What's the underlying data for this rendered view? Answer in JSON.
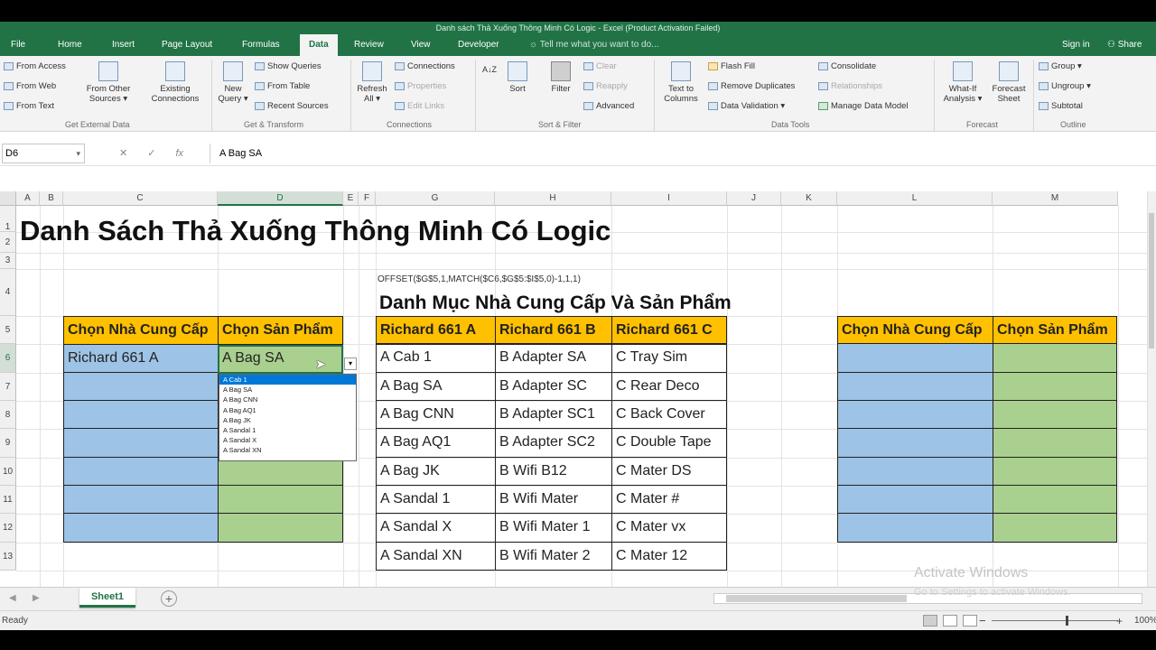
{
  "window": {
    "title": "Danh sách Thả Xuống Thông Minh Có Logic - Excel (Product Activation Failed)"
  },
  "ribbon_tabs": [
    "File",
    "Home",
    "Insert",
    "Page Layout",
    "Formulas",
    "Data",
    "Review",
    "View",
    "Developer"
  ],
  "active_tab": "Data",
  "tell_me": "Tell me what you want to do...",
  "sign_in": "Sign in",
  "share": "Share",
  "ribbon": {
    "get_external": {
      "from_access": "From Access",
      "from_web": "From Web",
      "from_text": "From Text",
      "from_other_1": "From Other",
      "from_other_2": "Sources ▾",
      "existing_1": "Existing",
      "existing_2": "Connections",
      "label": "Get External Data"
    },
    "get_transform": {
      "new_query_1": "New",
      "new_query_2": "Query ▾",
      "show_queries": "Show Queries",
      "from_table": "From Table",
      "recent_sources": "Recent Sources",
      "label": "Get & Transform"
    },
    "connections": {
      "refresh_1": "Refresh",
      "refresh_2": "All ▾",
      "connections": "Connections",
      "properties": "Properties",
      "edit_links": "Edit Links",
      "label": "Connections"
    },
    "sort_filter": {
      "sort": "Sort",
      "filter": "Filter",
      "clear": "Clear",
      "reapply": "Reapply",
      "advanced": "Advanced",
      "label": "Sort & Filter"
    },
    "data_tools": {
      "text_to_1": "Text to",
      "text_to_2": "Columns",
      "flash_fill": "Flash Fill",
      "remove_duplicates": "Remove Duplicates",
      "data_validation": "Data Validation ▾",
      "consolidate": "Consolidate",
      "relationships": "Relationships",
      "manage_model": "Manage Data Model",
      "label": "Data Tools"
    },
    "forecast": {
      "whatif_1": "What-If",
      "whatif_2": "Analysis ▾",
      "sheet_1": "Forecast",
      "sheet_2": "Sheet",
      "label": "Forecast"
    },
    "outline": {
      "group": "Group",
      "ungroup": "Ungroup",
      "subtotal": "Subtotal",
      "label": "Outline"
    }
  },
  "name_box": "D6",
  "formula_icons": {
    "cancel": "✕",
    "enter": "✓",
    "fx": "fx"
  },
  "formula": "A Bag SA",
  "columns": [
    "A",
    "B",
    "C",
    "D",
    "E",
    "F",
    "G",
    "H",
    "I",
    "J",
    "K",
    "L",
    "M"
  ],
  "rows": [
    "1",
    "2",
    "3",
    "4",
    "5",
    "6",
    "7",
    "8",
    "9",
    "10",
    "11",
    "12",
    "13"
  ],
  "sheet": {
    "title": "Danh Sách Thả Xuống Thông Minh Có Logic",
    "offset_formula": "OFFSET($G$5,1,MATCH($C6,$G$5:$I$5,0)-1,1,1)",
    "catalog_title": "Danh Mục Nhà Cung Cấp Và Sản Phẩm",
    "left_table": {
      "headers": [
        "Chọn Nhà Cung Cấp",
        "Chọn Sản Phẩm"
      ],
      "row1": [
        "Richard 661 A",
        "A Bag SA"
      ]
    },
    "catalog": {
      "headers": [
        "Richard 661 A",
        "Richard 661 B",
        "Richard 661 C"
      ],
      "rows": [
        [
          "A Cab 1",
          "B Adapter SA",
          "C Tray Sim"
        ],
        [
          "A Bag SA",
          "B Adapter SC",
          "C Rear Deco"
        ],
        [
          "A Bag CNN",
          "B Adapter SC1",
          "C Back Cover"
        ],
        [
          "A Bag AQ1",
          "B Adapter SC2",
          "C Double Tape"
        ],
        [
          "A Bag JK",
          "B Wifi B12",
          "C Mater DS"
        ],
        [
          "A Sandal 1",
          "B Wifi Mater",
          "C Mater #"
        ],
        [
          "A Sandal X",
          "B Wifi Mater 1",
          "C Mater vx"
        ],
        [
          "A Sandal XN",
          "B Wifi Mater 2",
          "C Mater 12"
        ]
      ]
    },
    "right_table": {
      "headers": [
        "Chọn Nhà Cung Cấp",
        "Chọn Sản Phẩm"
      ]
    }
  },
  "dropdown": {
    "arrow": "▾",
    "options": [
      "A Cab 1",
      "A Bag SA",
      "A Bag CNN",
      "A Bag AQ1",
      "A Bag JK",
      "A Sandal 1",
      "A Sandal X",
      "A Sandal XN"
    ],
    "selected_index": 0
  },
  "sheet_tabs": [
    "Sheet1"
  ],
  "add_sheet": "+",
  "watermark": {
    "line1": "Activate Windows",
    "line2": "Go to Settings to activate Windows."
  },
  "status": {
    "ready": "Ready",
    "zoom": "100%",
    "zoom_minus": "−",
    "zoom_plus": "+"
  },
  "colors": {
    "excel_green": "#217346",
    "header_orange": "#ffc000",
    "supplier_blue": "#9dc3e6",
    "product_green": "#a9d08e"
  }
}
